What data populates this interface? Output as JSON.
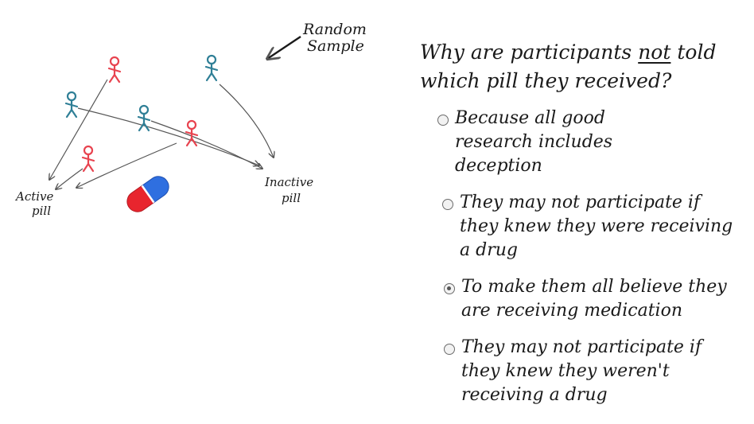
{
  "diagram": {
    "sample_label": [
      "Random",
      "Sample"
    ],
    "active_label": [
      "Active",
      "pill"
    ],
    "inactive_label": [
      "Inactive",
      "pill"
    ],
    "colors": {
      "red": "#e8434f",
      "blue": "#2f7f96",
      "arrow": "#555555",
      "pill_red": "#e8252e",
      "pill_blue": "#2f6fe0"
    },
    "figures": [
      "red",
      "blue",
      "blue",
      "blue",
      "red",
      "red"
    ],
    "icons": [
      "stick-figure-icon",
      "pill-capsule-icon",
      "arrow-icon"
    ]
  },
  "quiz": {
    "question_pre": "Why are participants ",
    "question_emph": "not",
    "question_post": " told which pill they received?",
    "options": [
      {
        "label": "Because all good research includes deception",
        "selected": false
      },
      {
        "label": "They may not participate if they knew they were receiving a drug",
        "selected": false
      },
      {
        "label": "To make them all believe they are receiving medication",
        "selected": true
      },
      {
        "label": "They may not participate if they knew they weren't receiving a drug",
        "selected": false
      }
    ]
  }
}
